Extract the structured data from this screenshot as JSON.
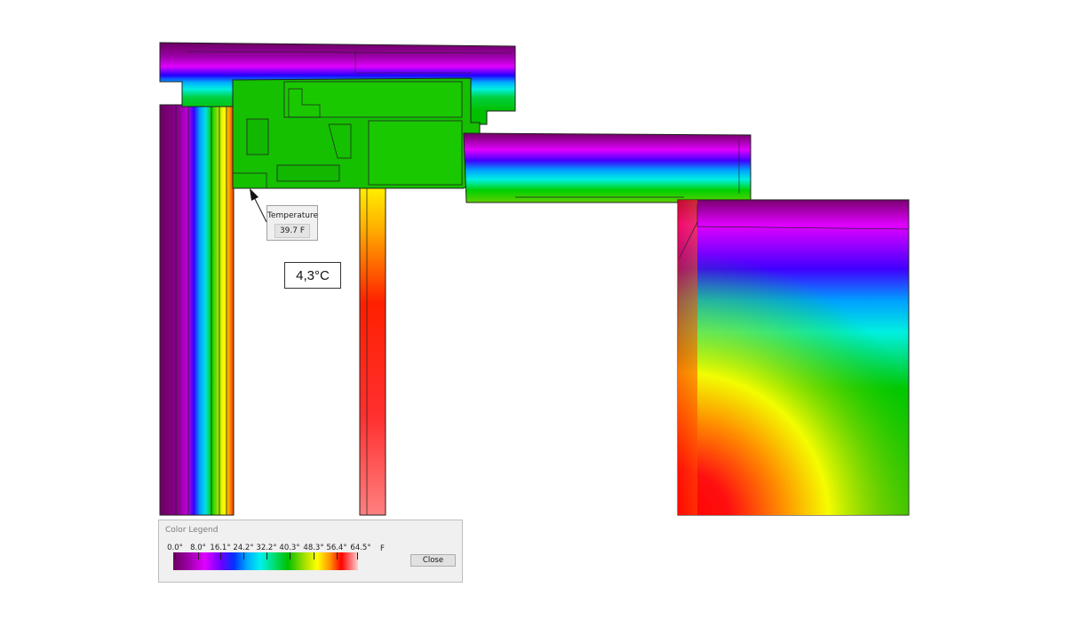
{
  "probe": {
    "title": "Temperature",
    "value": "39.7 F"
  },
  "annotation": {
    "celsius_label": "4,3°C"
  },
  "legend": {
    "title": "Color Legend",
    "unit": "F",
    "ticks": [
      "0.0°",
      "8.0°",
      "16.1°",
      "24.2°",
      "32.2°",
      "40.3°",
      "48.3°",
      "56.4°",
      "64.5°"
    ],
    "close_label": "Close",
    "scale_colors": [
      "#6b0060",
      "#e100ff",
      "#0033ff",
      "#00f0f0",
      "#00c000",
      "#ffff00",
      "#ff0000",
      "#ffd0d0"
    ]
  }
}
